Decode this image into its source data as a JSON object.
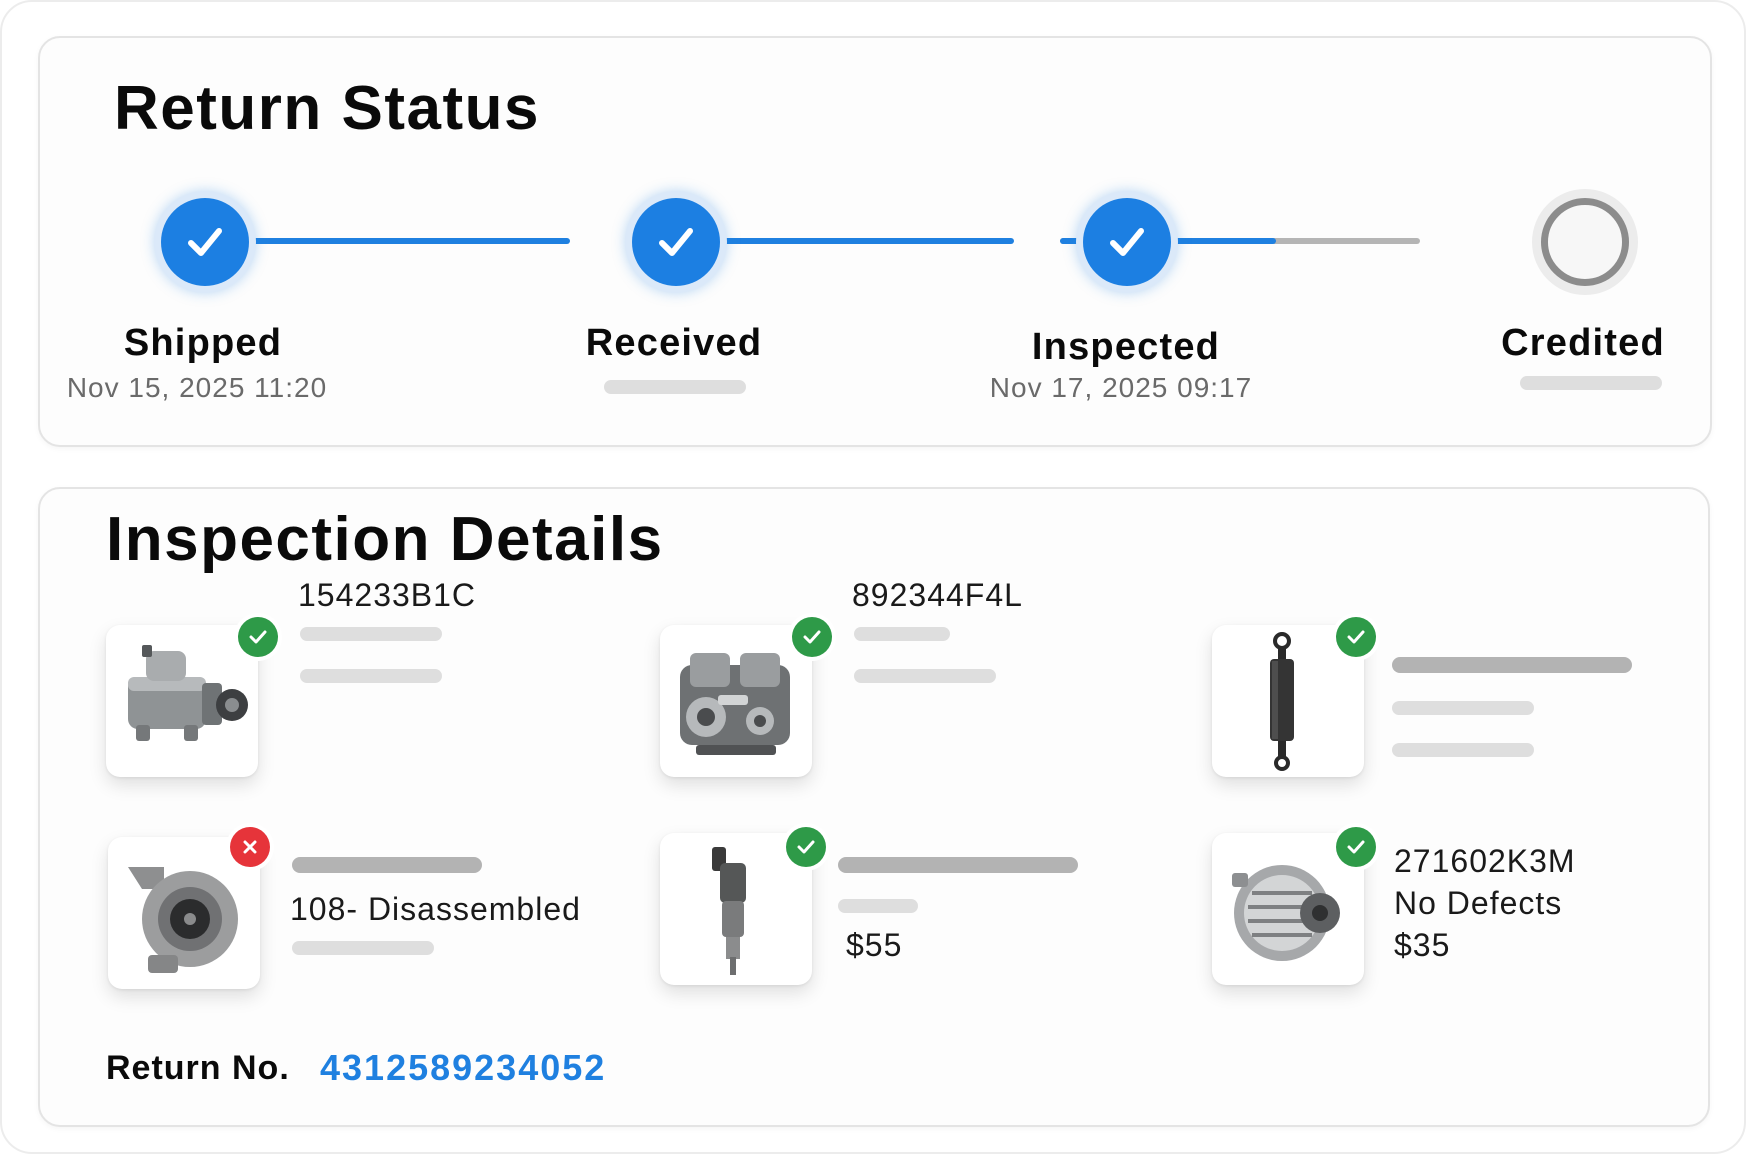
{
  "status_card": {
    "title": "Return Status",
    "steps": [
      {
        "label": "Shipped",
        "date": "Nov 15, 2025 11:20",
        "state": "complete"
      },
      {
        "label": "Received",
        "date": "",
        "state": "complete"
      },
      {
        "label": "Inspected",
        "date": "Nov 17, 2025 09:17",
        "state": "complete"
      },
      {
        "label": "Credited",
        "date": "",
        "state": "pending"
      }
    ],
    "last_segment_progress": 0.6
  },
  "details_card": {
    "title": "Inspection Details",
    "items": [
      {
        "part": "starter-motor",
        "status": "pass",
        "lines": [
          "154233B1C"
        ]
      },
      {
        "part": "engine-block",
        "status": "pass",
        "lines": [
          "892344F4L"
        ]
      },
      {
        "part": "hydraulic-cylinder",
        "status": "pass",
        "lines": []
      },
      {
        "part": "turbocharger",
        "status": "fail",
        "lines": [
          "108- Disassembled"
        ]
      },
      {
        "part": "fuel-injector",
        "status": "pass",
        "lines": [
          "$55"
        ]
      },
      {
        "part": "alternator",
        "status": "pass",
        "lines": [
          "271602K3M",
          "No Defects",
          "$35"
        ]
      }
    ],
    "return_label": "Return No.",
    "return_number": "4312589234052"
  },
  "colors": {
    "accent": "#1f80e0",
    "pass": "#2e9a48",
    "fail": "#e6343a",
    "pending_ring": "#8c8c8c"
  }
}
